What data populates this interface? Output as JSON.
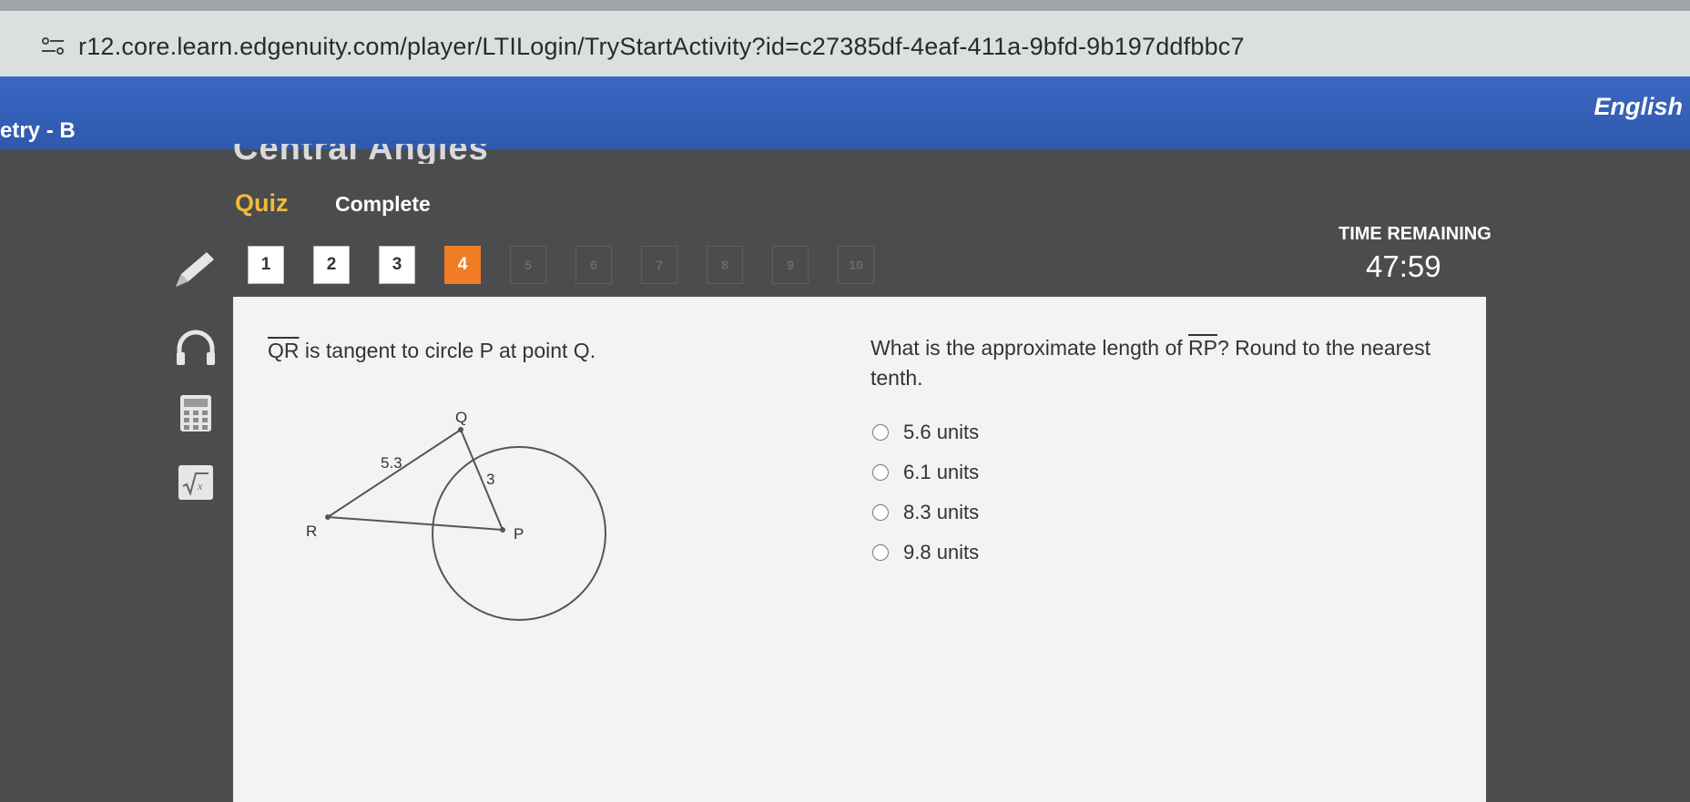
{
  "browser": {
    "url": "r12.core.learn.edgenuity.com/player/LTILogin/TryStartActivity?id=c27385df-4eaf-411a-9bfd-9b197ddfbbc7"
  },
  "header": {
    "course_title": "etry - B",
    "language": "English"
  },
  "activity": {
    "heading": "Central Angles",
    "type": "Quiz",
    "status": "Complete"
  },
  "question_nav": [
    {
      "label": "1",
      "state": "done"
    },
    {
      "label": "2",
      "state": "done"
    },
    {
      "label": "3",
      "state": "done"
    },
    {
      "label": "4",
      "state": "current"
    },
    {
      "label": "5",
      "state": "locked"
    },
    {
      "label": "6",
      "state": "locked"
    },
    {
      "label": "7",
      "state": "locked"
    },
    {
      "label": "8",
      "state": "locked"
    },
    {
      "label": "9",
      "state": "locked"
    },
    {
      "label": "10",
      "state": "locked"
    }
  ],
  "timer": {
    "label": "TIME REMAINING",
    "value": "47:59"
  },
  "tools": [
    "pencil-icon",
    "headphones-icon",
    "calculator-icon",
    "formula-icon"
  ],
  "question": {
    "segment": "QR",
    "statement_rest": " is tangent to circle P at point Q.",
    "prompt_before": "What is the approximate length of ",
    "prompt_segment": "RP",
    "prompt_after": "? Round to the nearest tenth.",
    "diagram": {
      "label_q": "Q",
      "label_r": "R",
      "label_p": "P",
      "len_qr": "5.3",
      "len_qp": "3"
    },
    "choices": [
      "5.6 units",
      "6.1 units",
      "8.3 units",
      "9.8 units"
    ]
  },
  "colors": {
    "header_blue": "#2f59ad",
    "current_orange": "#f07c24",
    "quiz_gold": "#f4b83c"
  }
}
